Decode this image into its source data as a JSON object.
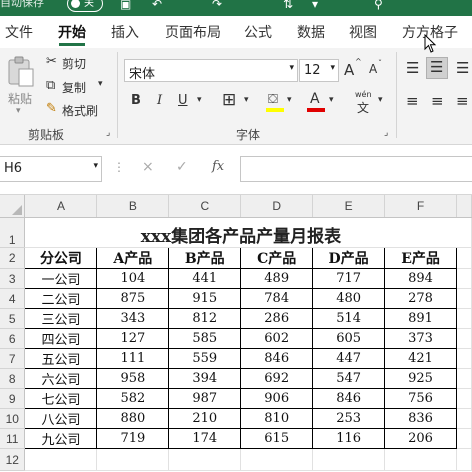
{
  "titlebar": {
    "autosave": "自动保存",
    "toggle": "关"
  },
  "tabs": [
    "文件",
    "开始",
    "插入",
    "页面布局",
    "公式",
    "数据",
    "视图",
    "方方格子"
  ],
  "clipboard": {
    "paste": "粘贴",
    "cut": "剪切",
    "copy": "复制",
    "format_painter": "格式刷",
    "group": "剪贴板"
  },
  "font": {
    "name": "宋体",
    "size": "12",
    "bold": "B",
    "italic": "I",
    "underline": "U",
    "grow": "A",
    "shrink": "A",
    "phonetic": "wén",
    "group": "字体"
  },
  "formula_bar": {
    "name_box": "H6",
    "cancel": "×",
    "enter": "✓",
    "fx": "fx",
    "value": ""
  },
  "sheet": {
    "columns": [
      "A",
      "B",
      "C",
      "D",
      "E",
      "F"
    ],
    "rows": [
      "1",
      "2",
      "3",
      "4",
      "5",
      "6",
      "7",
      "8",
      "9",
      "10",
      "11",
      "12"
    ],
    "title": "xxx集团各产品产量月报表",
    "headers": [
      "分公司",
      "A产品",
      "B产品",
      "C产品",
      "D产品",
      "E产品"
    ],
    "data": [
      [
        "一公司",
        "104",
        "441",
        "489",
        "717",
        "894"
      ],
      [
        "二公司",
        "875",
        "915",
        "784",
        "480",
        "278"
      ],
      [
        "三公司",
        "343",
        "812",
        "286",
        "514",
        "891"
      ],
      [
        "四公司",
        "127",
        "585",
        "602",
        "605",
        "373"
      ],
      [
        "五公司",
        "111",
        "559",
        "846",
        "447",
        "421"
      ],
      [
        "六公司",
        "958",
        "394",
        "692",
        "547",
        "925"
      ],
      [
        "七公司",
        "582",
        "987",
        "906",
        "846",
        "756"
      ],
      [
        "八公司",
        "880",
        "210",
        "810",
        "253",
        "836"
      ],
      [
        "九公司",
        "719",
        "174",
        "615",
        "116",
        "206"
      ]
    ]
  }
}
